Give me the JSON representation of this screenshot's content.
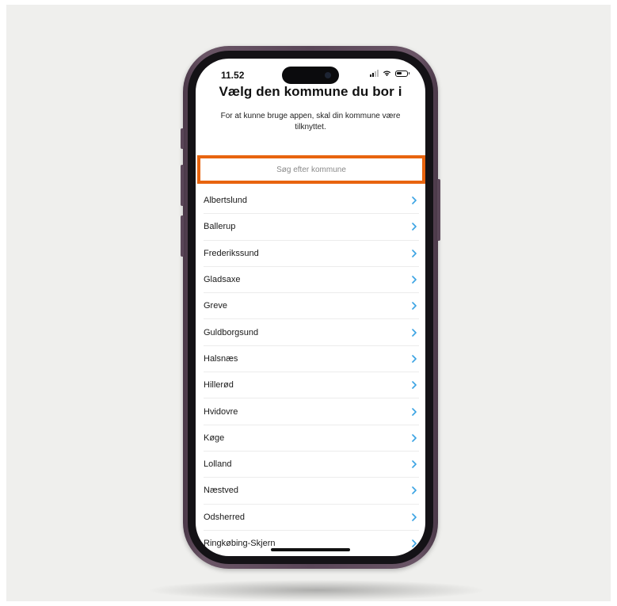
{
  "status_bar": {
    "time": "11.52",
    "icons": [
      "cellular-signal-icon",
      "wifi-icon",
      "battery-icon"
    ]
  },
  "header": {
    "title": "Vælg den kommune du bor i",
    "subtitle": "For at kunne bruge appen, skal din kommune være tilknyttet."
  },
  "search": {
    "placeholder": "Søg efter kommune",
    "value": ""
  },
  "municipalities": [
    "Albertslund",
    "Ballerup",
    "Frederikssund",
    "Gladsaxe",
    "Greve",
    "Guldborgsund",
    "Halsnæs",
    "Hillerød",
    "Hvidovre",
    "Køge",
    "Lolland",
    "Næstved",
    "Odsherred",
    "Ringkøbing-Skjern"
  ],
  "colors": {
    "highlight": "#e8640f",
    "chevron": "#3aa3e3",
    "phone_frame": "#5a4658"
  }
}
